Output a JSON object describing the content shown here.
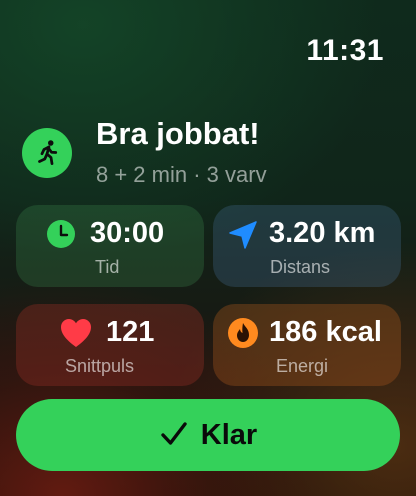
{
  "status_bar": {
    "time": "11:31"
  },
  "summary": {
    "title": "Bra jobbat!",
    "subtitle": "8 + 2 min · 3 varv",
    "icon": "running-figure-icon"
  },
  "stats": {
    "time": {
      "value": "30:00",
      "label": "Tid",
      "icon": "clock-icon"
    },
    "distance": {
      "value": "3.20 km",
      "label": "Distans",
      "icon": "location-arrow-icon"
    },
    "heart": {
      "value": "121",
      "label": "Snittpuls",
      "icon": "heart-icon"
    },
    "energy": {
      "value": "186 kcal",
      "label": "Energi",
      "icon": "flame-icon"
    }
  },
  "done_button": {
    "label": "Klar",
    "icon": "checkmark-icon"
  },
  "colors": {
    "accent_green": "#34d15a",
    "distance_blue": "#1f8cff",
    "heart_red": "#ff3b47",
    "energy_orange": "#ff8a1f"
  }
}
